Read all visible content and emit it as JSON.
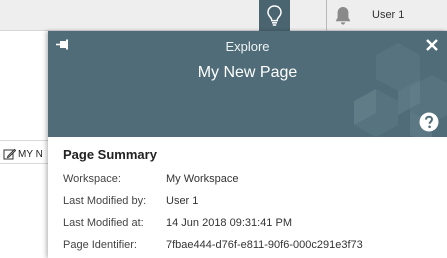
{
  "topbar": {
    "user_label": "User 1"
  },
  "background": {
    "edit_label": "MY N"
  },
  "panel": {
    "eyebrow": "Explore",
    "title": "My New Page",
    "summary": {
      "heading": "Page Summary",
      "rows": [
        {
          "label": "Workspace:",
          "value": "My Workspace"
        },
        {
          "label": "Last Modified by:",
          "value": "User 1"
        },
        {
          "label": "Last Modified at:",
          "value": "14 Jun 2018 09:31:41 PM"
        },
        {
          "label": "Page Identifier:",
          "value": "7fbae444-d76f-e811-90f6-000c291e3f73"
        }
      ]
    }
  },
  "colors": {
    "header_bg": "#4f6c78",
    "active_button_bg": "#4a6570",
    "topbar_bg": "#eeeeee"
  },
  "icons": [
    "lightbulb-icon",
    "bell-icon",
    "pin-icon",
    "close-icon",
    "help-icon",
    "edit-icon"
  ]
}
